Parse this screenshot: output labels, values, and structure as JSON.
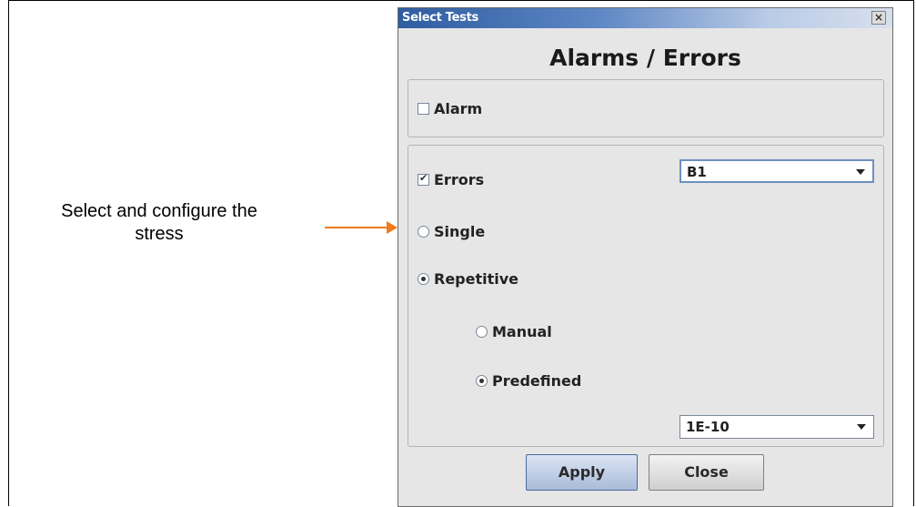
{
  "annotation": {
    "caption_line1": "Select and configure the",
    "caption_line2": "stress"
  },
  "dialog": {
    "title": "Select Tests",
    "close_glyph": "×",
    "heading": "Alarms / Errors",
    "alarm": {
      "label": "Alarm",
      "checked": false
    },
    "errors": {
      "label": "Errors",
      "checked": true,
      "type_value": "B1"
    },
    "mode": {
      "single_label": "Single",
      "repetitive_label": "Repetitive",
      "selected": "Repetitive"
    },
    "repetitive": {
      "manual_label": "Manual",
      "predefined_label": "Predefined",
      "selected": "Predefined",
      "rate_value": "1E-10"
    },
    "buttons": {
      "apply": "Apply",
      "close": "Close"
    }
  },
  "colors": {
    "accent_arrow": "#f07a1e",
    "titlebar": "#2e5da0"
  }
}
